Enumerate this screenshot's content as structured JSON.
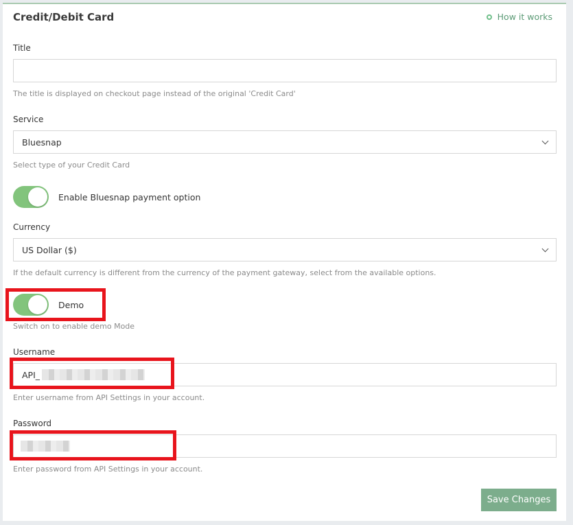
{
  "panel": {
    "title": "Credit/Debit Card",
    "how_it_works": "How it works"
  },
  "title_field": {
    "label": "Title",
    "value": "",
    "help": "The title is displayed on checkout page instead of the original 'Credit Card'"
  },
  "service": {
    "label": "Service",
    "selected": "Bluesnap",
    "help": "Select type of your Credit Card"
  },
  "enable_toggle": {
    "label": "Enable Bluesnap payment option",
    "on": true
  },
  "currency": {
    "label": "Currency",
    "selected": "US Dollar ($)",
    "help": "If the default currency is different from the currency of the payment gateway, select from the available options."
  },
  "demo_toggle": {
    "label": "Demo",
    "on": true,
    "help": "Switch on to enable demo Mode"
  },
  "username": {
    "label": "Username",
    "value_prefix": "API_",
    "help": "Enter username from API Settings in your account."
  },
  "password": {
    "label": "Password",
    "help": "Enter password from API Settings in your account."
  },
  "actions": {
    "save_label": "Save Changes"
  },
  "colors": {
    "accent": "#7cad8c",
    "toggle_on": "#82c47c",
    "highlight": "#e8141c"
  }
}
